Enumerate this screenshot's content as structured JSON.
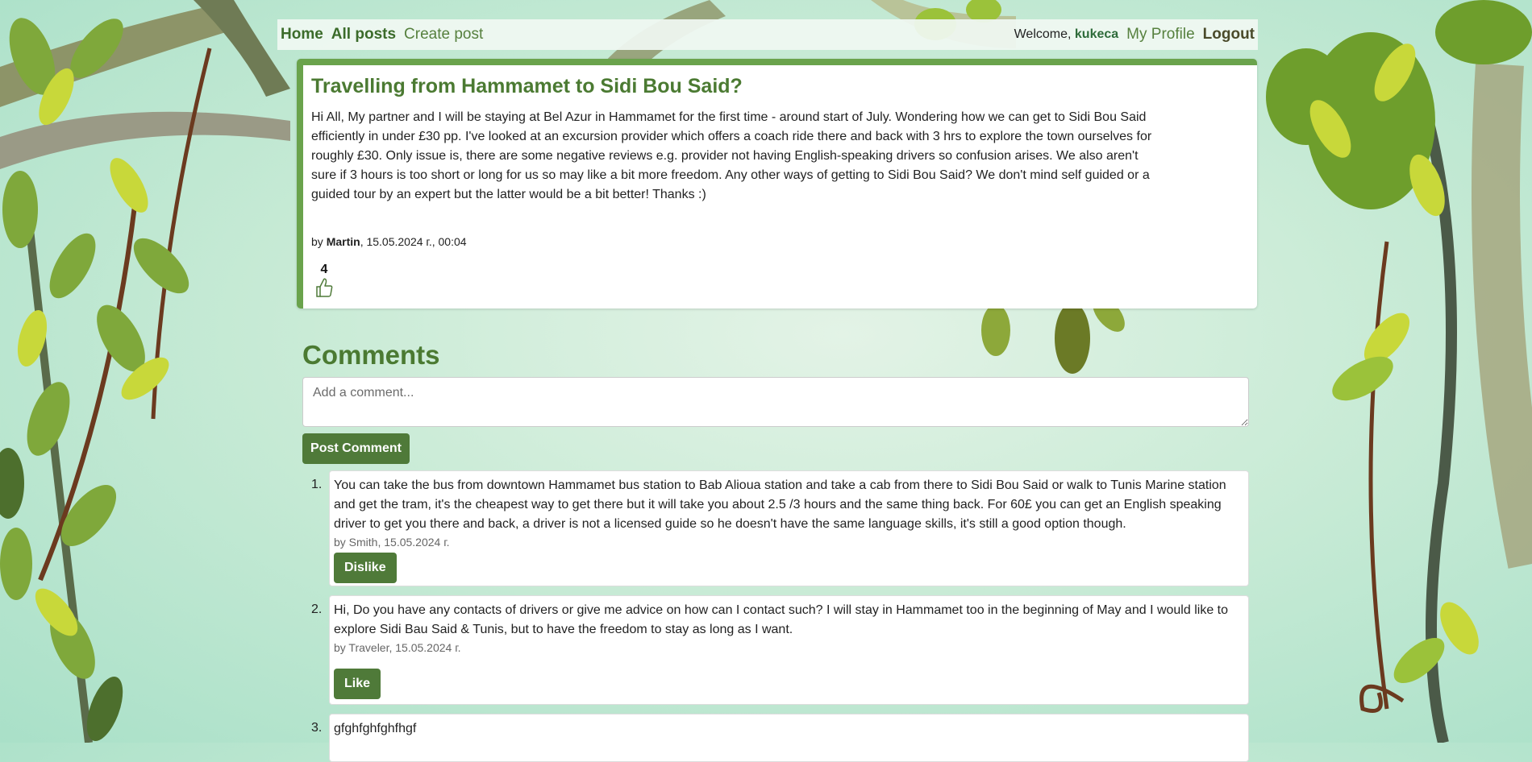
{
  "nav": {
    "home": "Home",
    "all_posts": "All posts",
    "create_post": "Create post",
    "welcome_prefix": "Welcome,",
    "username": "kukeca",
    "my_profile": "My Profile",
    "logout": "Logout"
  },
  "post": {
    "title": "Travelling from Hammamet to Sidi Bou Said?",
    "body": "Hi All, My partner and I will be staying at Bel Azur in Hammamet for the first time - around start of July. Wondering how we can get to Sidi Bou Said efficiently in under £30 pp. I've looked at an excursion provider which offers a coach ride there and back with 3 hrs to explore the town ourselves for roughly £30. Only issue is, there are some negative reviews e.g. provider not having English-speaking drivers so confusion arises. We also aren't sure if 3 hours is too short or long for us so may like a bit more freedom. Any other ways of getting to Sidi Bou Said? We don't mind self guided or a guided tour by an expert but the latter would be a bit better! Thanks :)",
    "by": "by",
    "author": "Martin",
    "date": ", 15.05.2024 г., 00:04",
    "likes": "4"
  },
  "comments": {
    "title": "Comments",
    "placeholder": "Add a comment...",
    "submit": "Post Comment",
    "items": [
      {
        "num": "1.",
        "text": "You can take the bus from downtown Hammamet bus station to Bab Alioua station and take a cab from there to Sidi Bou Said or walk to Tunis Marine station and get the tram, it's the cheapest way to get there but it will take you about 2.5 /3 hours and the same thing back. For 60£ you can get an English speaking driver to get you there and back, a driver is not a licensed guide so he doesn't have the same language skills, it's still a good option though.",
        "meta": "by Smith, 15.05.2024 г.",
        "button": "Dislike"
      },
      {
        "num": "2.",
        "text": "Hi, Do you have any contacts of drivers or give me advice on how can I contact such? I will stay in Hammamet too in the beginning of May and I would like to explore Sidi Bau Said & Tunis, but to have the freedom to stay as long as I want.",
        "meta": "by Traveler, 15.05.2024 г.",
        "button": "Like"
      },
      {
        "num": "3.",
        "text": "gfghfghfghfhgf"
      }
    ]
  },
  "colors": {
    "accent": "#4f7a39",
    "title": "#4b7a32",
    "card_border": "#6aa34c"
  },
  "icons": {
    "like": "thumbs-up-icon"
  }
}
